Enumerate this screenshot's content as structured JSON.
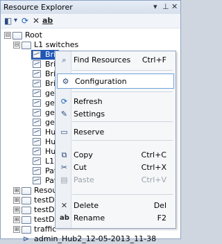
{
  "panel": {
    "title": "Resource Explorer",
    "controls": {
      "dropdown": "▾",
      "pin": "⊥",
      "close": "✕"
    }
  },
  "toolbar": {
    "new_icon": "◧",
    "dropdown_icon": "▾",
    "refresh_icon": "⟳",
    "delete_icon": "✕",
    "rename_icon": "ab"
  },
  "tree": {
    "root": {
      "label": "Root",
      "expander": "⊟"
    },
    "l1": {
      "label": "L1 switches",
      "expander": "⊟"
    },
    "items": [
      {
        "label": "Brid",
        "selected": true
      },
      {
        "label": "Brid"
      },
      {
        "label": "Brid"
      },
      {
        "label": "Brid"
      },
      {
        "label": "gen"
      },
      {
        "label": "gen"
      },
      {
        "label": "gen"
      },
      {
        "label": "gen"
      },
      {
        "label": "Hub"
      },
      {
        "label": "Hub"
      },
      {
        "label": "Hub"
      },
      {
        "label": "L1"
      },
      {
        "label": "Pat"
      },
      {
        "label": "Pat"
      }
    ],
    "folders": [
      {
        "label": "Resou",
        "expander": "⊞"
      },
      {
        "label": "testDo",
        "expander": "⊞"
      },
      {
        "label": "testDo",
        "expander": "⊞"
      },
      {
        "label": "testDo",
        "expander": "⊞"
      },
      {
        "label": "traffic",
        "expander": "⊞"
      }
    ],
    "session": {
      "label": "admin_Hub2_12-05-2013_11-38"
    }
  },
  "context_menu": {
    "find": {
      "label": "Find Resources",
      "shortcut": "Ctrl+F",
      "icon": "search-icon"
    },
    "configuration": {
      "label": "Configuration",
      "icon": "gear-icon"
    },
    "refresh": {
      "label": "Refresh",
      "icon": "refresh-icon"
    },
    "settings": {
      "label": "Settings",
      "icon": "wrench-icon"
    },
    "reserve": {
      "label": "Reserve",
      "icon": "reserve-icon"
    },
    "copy": {
      "label": "Copy",
      "shortcut": "Ctrl+C",
      "icon": "copy-icon"
    },
    "cut": {
      "label": "Cut",
      "shortcut": "Ctrl+X",
      "icon": "scissors-icon"
    },
    "paste": {
      "label": "Paste",
      "shortcut": "Ctrl+V",
      "icon": "paste-icon",
      "disabled": true
    },
    "delete": {
      "label": "Delete",
      "shortcut": "Del",
      "icon": "delete-icon"
    },
    "rename": {
      "label": "Rename",
      "shortcut": "F2",
      "icon": "rename-icon"
    }
  }
}
